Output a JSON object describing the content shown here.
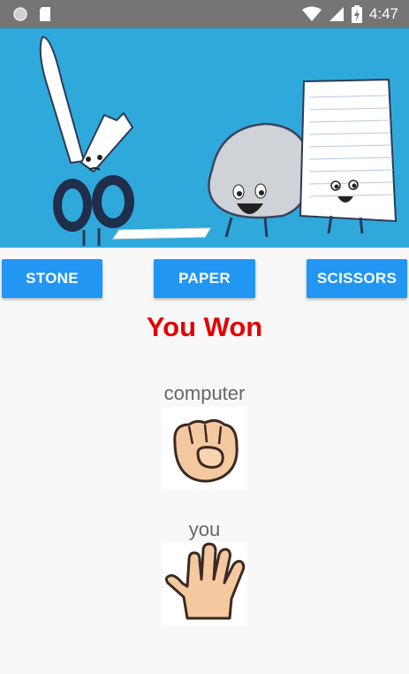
{
  "status_bar": {
    "time": "4:47"
  },
  "buttons": {
    "stone": "STONE",
    "paper": "PAPER",
    "scissors": "SCISSORS"
  },
  "result": {
    "text": "You Won",
    "color": "#e40000"
  },
  "computer": {
    "label": "computer",
    "choice_icon": "fist-icon"
  },
  "player": {
    "label": "you",
    "choice_icon": "open-hand-icon"
  },
  "colors": {
    "button": "#2196f3",
    "hero_bg": "#2fa9db",
    "status_bar": "#757575"
  }
}
